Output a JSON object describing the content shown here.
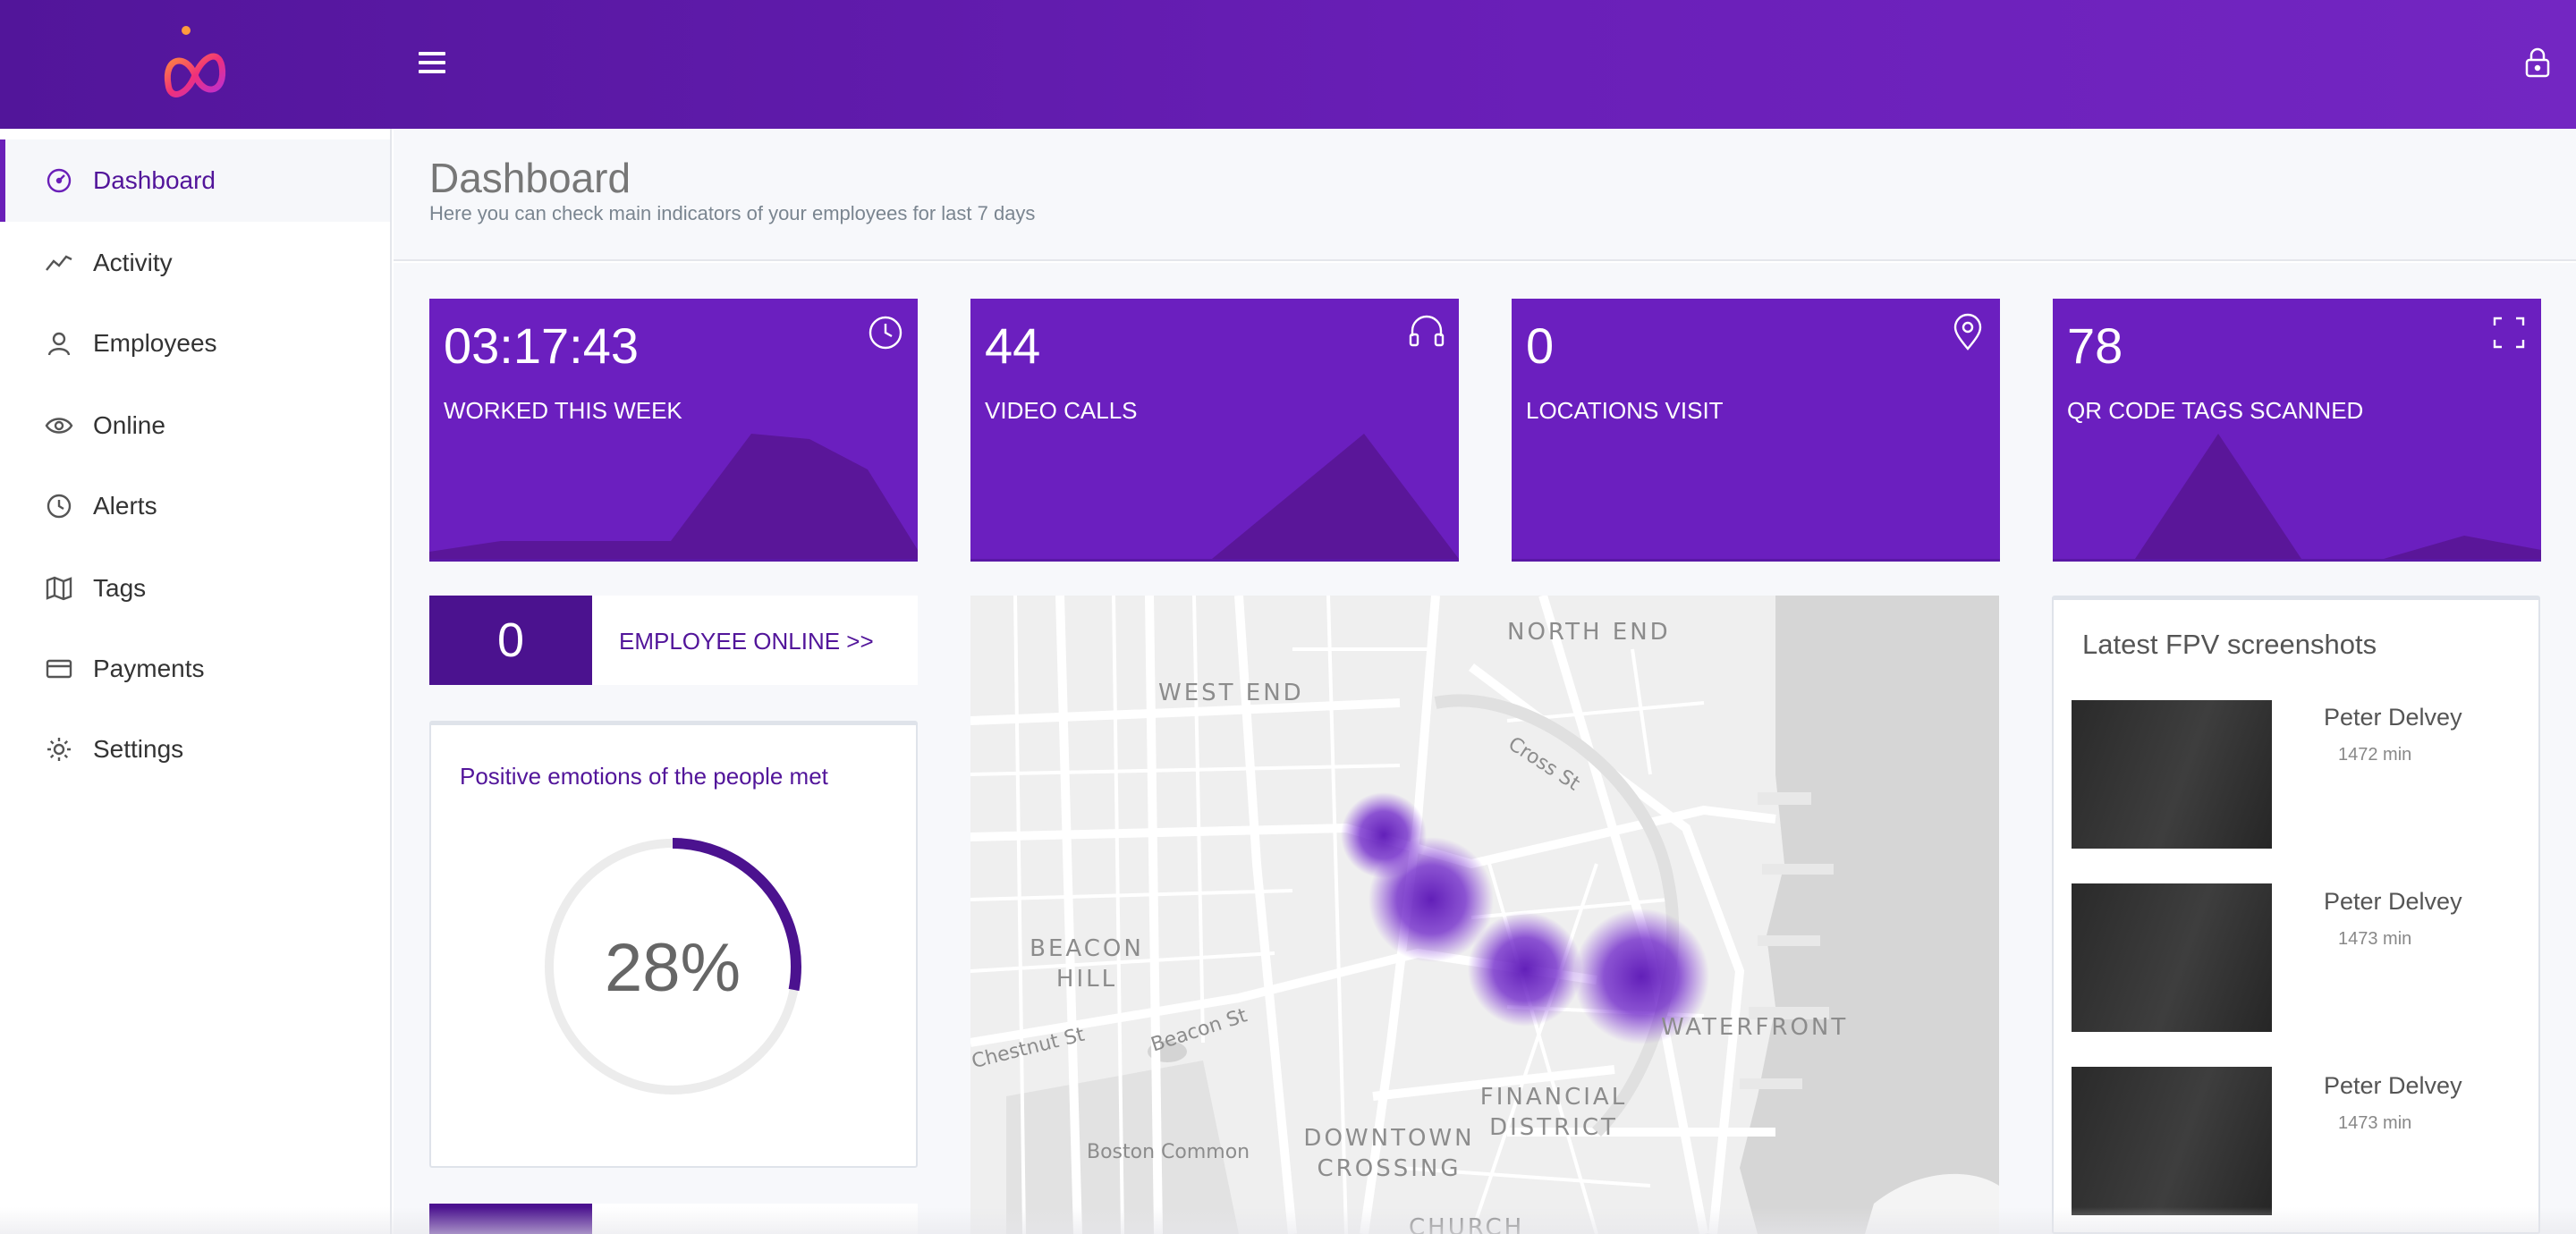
{
  "header": {
    "logo_icon": "brand-logo-icon",
    "menu_icon": "hamburger-icon",
    "lock_icon": "lock-icon",
    "colors": {
      "bar": "#6a1fb8",
      "accent": "#52159a"
    }
  },
  "sidebar": {
    "items": [
      {
        "label": "Dashboard",
        "icon": "speedometer-icon",
        "active": true
      },
      {
        "label": "Activity",
        "icon": "trend-line-icon"
      },
      {
        "label": "Employees",
        "icon": "user-icon"
      },
      {
        "label": "Online",
        "icon": "eye-icon"
      },
      {
        "label": "Alerts",
        "icon": "clock-icon"
      },
      {
        "label": "Tags",
        "icon": "map-icon"
      },
      {
        "label": "Payments",
        "icon": "credit-card-icon"
      },
      {
        "label": "Settings",
        "icon": "gear-icon"
      }
    ]
  },
  "page": {
    "title": "Dashboard",
    "subtitle": "Here you can check main indicators of your employees for last 7 days"
  },
  "stats": [
    {
      "value": "03:17:43",
      "label": "WORKED THIS WEEK",
      "icon": "clock-icon"
    },
    {
      "value": "44",
      "label": "VIDEO CALLS",
      "icon": "headset-icon"
    },
    {
      "value": "0",
      "label": "LOCATIONS VISIT",
      "icon": "location-pin-icon"
    },
    {
      "value": "78",
      "label": "QR CODE TAGS SCANNED",
      "icon": "scan-frame-icon"
    }
  ],
  "online": {
    "count": "0",
    "link": "EMPLOYEE ONLINE >>"
  },
  "emotions": {
    "title": "Positive emotions of the people met",
    "percent_text": "28%",
    "percent": 0.28
  },
  "map": {
    "districts": [
      "NORTH END",
      "WEST END",
      "BEACON HILL",
      "WATERFRONT",
      "FINANCIAL DISTRICT",
      "DOWNTOWN CROSSING",
      "CHURCH"
    ],
    "streets": [
      "Cross St",
      "Chestnut St",
      "Beacon St",
      "Boston Common"
    ]
  },
  "fpv": {
    "title": "Latest FPV screenshots",
    "items": [
      {
        "name": "Peter Delvey",
        "minutes": "1472 min"
      },
      {
        "name": "Peter Delvey",
        "minutes": "1473 min"
      },
      {
        "name": "Peter Delvey",
        "minutes": "1473 min"
      }
    ]
  }
}
